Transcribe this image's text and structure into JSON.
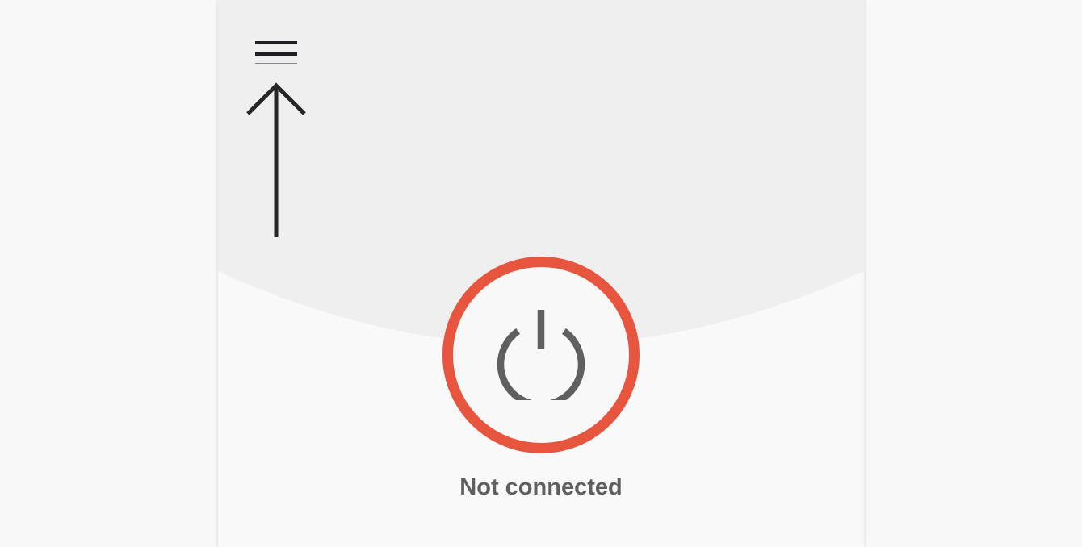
{
  "app": {
    "menu_icon": "hamburger-menu-icon",
    "hint_icon": "up-arrow-icon",
    "power_icon": "power-icon"
  },
  "connection": {
    "status_text": "Not connected",
    "ring_color": "#e8553e",
    "icon_color": "#606060"
  },
  "colors": {
    "page_background": "#f8f8f8",
    "header_background": "#efefef",
    "panel_background": "#f9f9f9"
  }
}
